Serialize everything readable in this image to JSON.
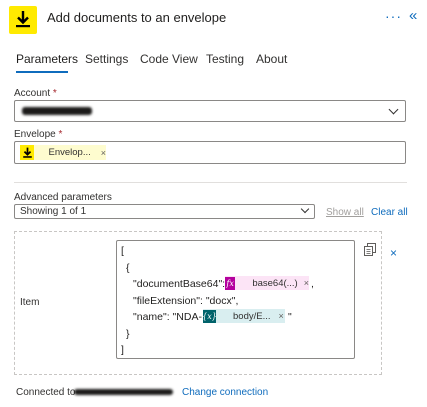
{
  "header": {
    "title": "Add documents to an envelope",
    "more_glyph": "···",
    "collapse_glyph": "«"
  },
  "tabs": [
    {
      "label": "Parameters",
      "active": true
    },
    {
      "label": "Settings"
    },
    {
      "label": "Code View"
    },
    {
      "label": "Testing"
    },
    {
      "label": "About"
    }
  ],
  "account": {
    "label": "Account",
    "required_mark": "*"
  },
  "envelope": {
    "label": "Envelope",
    "required_mark": "*",
    "token": {
      "text": "Envelop...",
      "remove": "×"
    }
  },
  "advanced": {
    "label": "Advanced parameters",
    "select_value": "Showing 1 of 1",
    "show_all": "Show all",
    "clear_all": "Clear all"
  },
  "item": {
    "label": "Item",
    "open_bracket": "[",
    "open_brace": "{",
    "doc_key": "\"documentBase64\": ",
    "doc_token": {
      "text": "base64(...)",
      "remove": "×",
      "color": "#b4009e",
      "bg": "#fce4f6"
    },
    "doc_suffix": ",",
    "ext_line": "\"fileExtension\": \"docx\",",
    "name_key": "\"name\": \"NDA-",
    "name_token": {
      "text": "body/E...",
      "remove": "×",
      "color": "#00626a",
      "bg": "#d9eef0"
    },
    "name_suffix": "\"",
    "close_brace": "}",
    "close_bracket": "]",
    "remove_glyph": "×"
  },
  "footer": {
    "connected_prefix": "Connected to",
    "change_link": "Change connection"
  },
  "colors": {
    "accent": "#0f6cbd",
    "docusign_yellow": "#ffea00"
  }
}
